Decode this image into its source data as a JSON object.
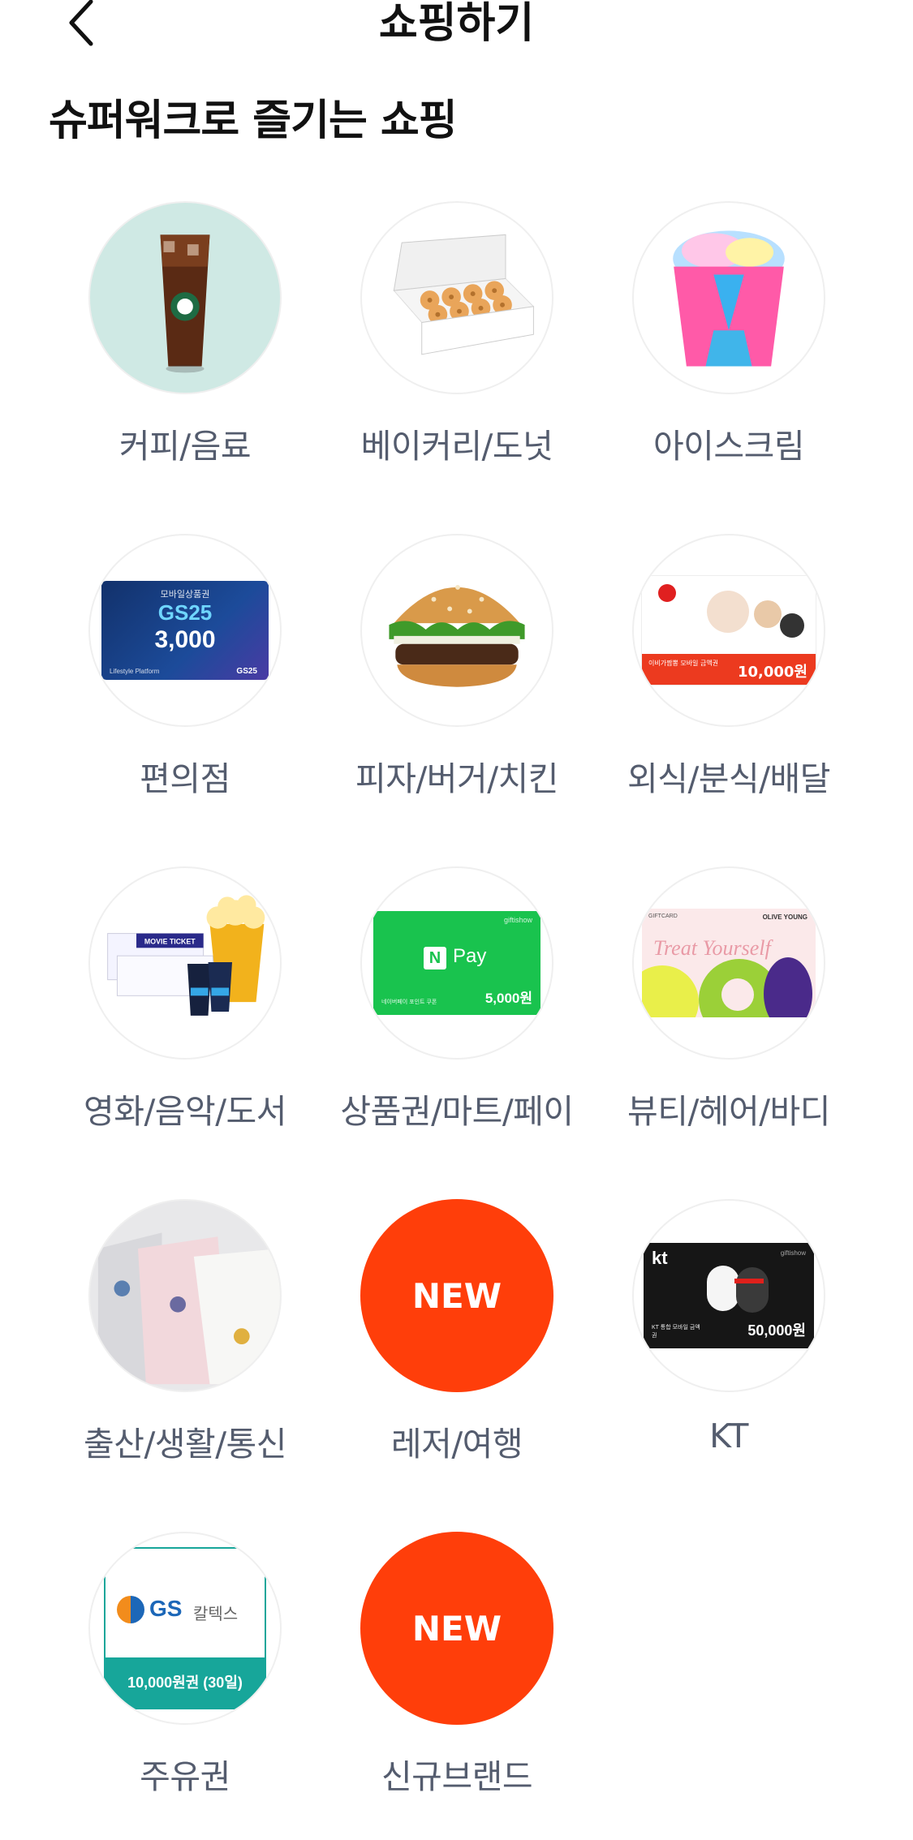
{
  "header": {
    "title": "쇼핑하기",
    "back_icon": "chevron-left-icon"
  },
  "section": {
    "title": "슈퍼워크로 즐기는 쇼핑"
  },
  "categories": [
    {
      "label": "커피/음료",
      "icon": "iced-coffee-image"
    },
    {
      "label": "베이커리/도넛",
      "icon": "donut-box-image"
    },
    {
      "label": "아이스크림",
      "icon": "ice-cream-cup-image"
    },
    {
      "label": "편의점",
      "icon": "gs25-card-image",
      "card": {
        "top": "모바일상품권",
        "brand": "GS25",
        "amount": "3,000",
        "footer": "Lifestyle Platform",
        "footer_brand": "GS25"
      }
    },
    {
      "label": "피자/버거/치킨",
      "icon": "burger-image"
    },
    {
      "label": "외식/분식/배달",
      "icon": "dining-card-image",
      "card": {
        "amount": "10,000원",
        "sub": "이비가짬뽕 모바일 금액권"
      }
    },
    {
      "label": "영화/음악/도서",
      "icon": "movie-ticket-image",
      "card": {
        "ticket": "MOVIE TICKET"
      }
    },
    {
      "label": "상품권/마트/페이",
      "icon": "npay-card-image",
      "card": {
        "brand": "Pay",
        "badge": "N",
        "amount": "5,000원",
        "sub": "네이버페이 포인트 쿠폰",
        "corner": "giftishow"
      }
    },
    {
      "label": "뷰티/헤어/바디",
      "icon": "oliveyoung-card-image",
      "card": {
        "top_left": "GIFTCARD",
        "top_right": "OLIVE YOUNG",
        "script": "Treat Yourself"
      }
    },
    {
      "label": "출산/생활/통신",
      "icon": "towels-image"
    },
    {
      "label": "레저/여행",
      "icon": "new-badge",
      "new_text": "NEW"
    },
    {
      "label": "KT",
      "icon": "kt-card-image",
      "card": {
        "brand": "kt",
        "amount": "50,000원",
        "sub": "KT 통합 모바일 금액권",
        "corner": "giftishow"
      }
    },
    {
      "label": "주유권",
      "icon": "gs-caltex-card-image",
      "card": {
        "brand": "GS",
        "brand2": "칼텍스",
        "amount": "10,000원권 (30일)"
      }
    },
    {
      "label": "신규브랜드",
      "icon": "new-badge",
      "new_text": "NEW"
    }
  ],
  "colors": {
    "accent": "#ff3e0a",
    "label": "#545c6e",
    "title": "#111111"
  }
}
